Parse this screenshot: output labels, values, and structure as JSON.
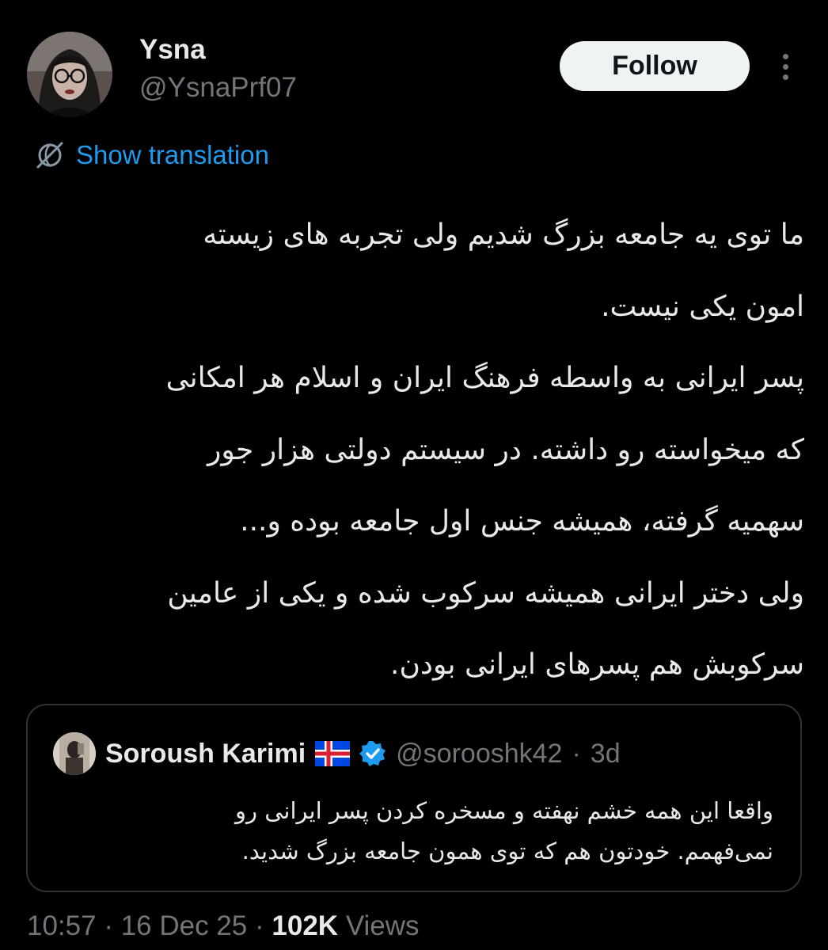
{
  "author": {
    "display_name": "Ysna",
    "handle": "@YsnaPrf07"
  },
  "actions": {
    "follow_label": "Follow"
  },
  "translation": {
    "label": "Show translation"
  },
  "tweet": {
    "lines": [
      "ما توی یه جامعه بزرگ شدیم ولی تجربه های زیسته",
      "امون یکی نیست.",
      "پسر ایرانی به واسطه فرهنگ ایران و اسلام هر امکانی",
      "که میخواسته رو داشته. در سیستم دولتی هزار جور",
      "سهمیه گرفته، همیشه جنس اول جامعه بوده و...",
      "ولی دختر ایرانی همیشه سرکوب شده و یکی از عامین",
      "سرکوبش هم پسرهای ایرانی بودن."
    ]
  },
  "quote": {
    "display_name": "Soroush Karimi",
    "handle": "@sorooshk42",
    "separator": "·",
    "age": "3d",
    "lines": [
      "واقعا این همه خشم نهفته و مسخره کردن پسر ایرانی رو",
      "نمی‌فهمم. خودتون هم که توی همون جامعه بزرگ شدید."
    ]
  },
  "meta": {
    "time": "10:57",
    "separator": "·",
    "date": "16 Dec 25",
    "views_count": "102K",
    "views_label": "Views"
  },
  "colors": {
    "background": "#000000",
    "text_primary": "#e7e9ea",
    "text_secondary": "#71767b",
    "accent_link": "#1d9bf0",
    "verified_badge": "#1d9bf0",
    "follow_bg": "#eff3f4",
    "border": "#2f3336"
  },
  "icons": {
    "more": "more-dots-icon",
    "translate": "translate-globe-icon",
    "flag": "iceland-flag-icon",
    "verified": "verified-badge-icon"
  }
}
